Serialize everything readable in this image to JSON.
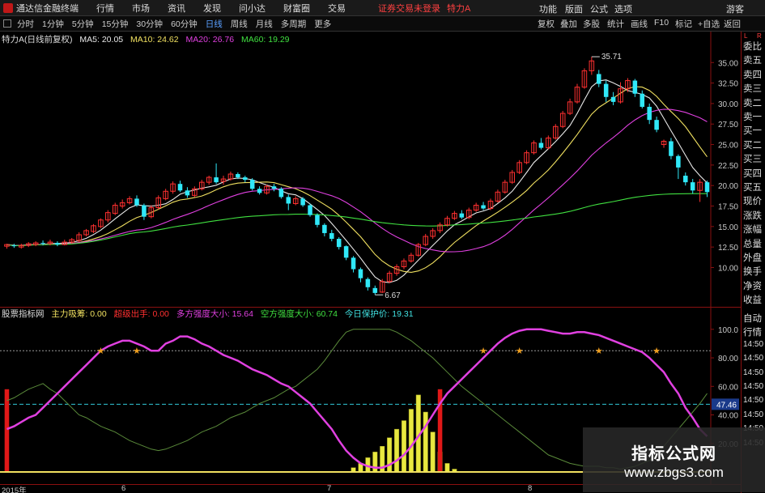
{
  "menubar": {
    "app_title": "通达信金融终端",
    "items": [
      "行情",
      "市场",
      "资讯",
      "发现",
      "问小达",
      "财富圈",
      "交易"
    ],
    "warning": "证券交易未登录",
    "stock_name": "特力A",
    "right_items": [
      "功能",
      "版面",
      "公式",
      "选项",
      "游客"
    ]
  },
  "toolbar": {
    "periods": [
      "分时",
      "1分钟",
      "5分钟",
      "15分钟",
      "30分钟",
      "60分钟",
      "日线",
      "周线",
      "月线",
      "多周期",
      "更多"
    ],
    "active_period": "日线",
    "right_items": [
      "复权",
      "叠加",
      "多股",
      "统计",
      "画线",
      "F10",
      "标记",
      "+自选",
      "返回"
    ]
  },
  "main_legend": {
    "title": "特力A(日线前复权)",
    "items": [
      {
        "text": "MA5: 20.05",
        "color": "#e8e8e8"
      },
      {
        "text": "MA10: 24.62",
        "color": "#f0e060"
      },
      {
        "text": "MA20: 26.76",
        "color": "#e040e0"
      },
      {
        "text": "MA60: 19.29",
        "color": "#40e040"
      }
    ]
  },
  "indicator_legend": {
    "title": "股票指标网",
    "items": [
      {
        "text": "主力吸筹: 0.00",
        "color": "#f0e060"
      },
      {
        "text": "超级出手: 0.00",
        "color": "#ff3030"
      },
      {
        "text": "多方强度大小: 15.64",
        "color": "#e040e0"
      },
      {
        "text": "空方强度大小: 60.74",
        "color": "#40e040"
      },
      {
        "text": "今日保护价: 19.31",
        "color": "#40e0e0"
      }
    ]
  },
  "main_axis_labels": [
    "35.00",
    "32.50",
    "30.00",
    "27.50",
    "25.00",
    "22.50",
    "20.00",
    "17.50",
    "15.00",
    "12.50",
    "10.00"
  ],
  "indicator_axis_labels": [
    "100.0",
    "80.00",
    "60.00",
    "40.00",
    "20.00"
  ],
  "indicator_current_value": "47.46",
  "price_annotations": {
    "high": "35.71",
    "low": "6.67"
  },
  "x_axis_labels": [
    "2015年",
    "6",
    "7",
    "8"
  ],
  "right_panel_items": [
    "委比",
    "卖五",
    "卖四",
    "卖三",
    "卖二",
    "卖一",
    "买一",
    "买二",
    "买三",
    "买四",
    "买五",
    "现价",
    "涨跌",
    "涨幅",
    "总量",
    "外盘",
    "换手",
    "净资",
    "收益",
    "自动",
    "行情",
    "14:50",
    "14:50",
    "14:50",
    "14:50",
    "14:50",
    "14:50",
    "14:50",
    "14:50"
  ],
  "right_panel_lr": [
    "L",
    "R"
  ],
  "watermark": {
    "title": "指标公式网",
    "url": "www.zbgs3.com"
  },
  "colors": {
    "up": "#ff3030",
    "down": "#30e8f8",
    "ma5": "#e8e8e8",
    "ma10": "#f0e060",
    "ma20": "#e040e0",
    "ma60": "#40e040",
    "grid": "#8a1010"
  },
  "chart_data": {
    "type": "candlestick",
    "title": "特力A(日线前复权)",
    "ylim": [
      6,
      37
    ],
    "candles": [
      [
        12.6,
        12.8,
        12.3,
        12.9
      ],
      [
        12.7,
        12.6,
        12.4,
        12.9
      ],
      [
        12.5,
        12.7,
        12.3,
        12.9
      ],
      [
        12.7,
        12.9,
        12.5,
        13.1
      ],
      [
        12.8,
        13.0,
        12.6,
        13.2
      ],
      [
        13.0,
        12.9,
        12.7,
        13.3
      ],
      [
        12.9,
        13.1,
        12.7,
        13.4
      ],
      [
        13.0,
        12.8,
        12.6,
        13.2
      ],
      [
        12.8,
        13.1,
        12.7,
        13.4
      ],
      [
        13.1,
        13.4,
        12.9,
        13.6
      ],
      [
        13.3,
        14.0,
        13.1,
        14.3
      ],
      [
        14.0,
        14.5,
        13.8,
        14.7
      ],
      [
        14.4,
        15.1,
        14.2,
        15.3
      ],
      [
        15.0,
        15.8,
        14.8,
        16.0
      ],
      [
        15.8,
        16.7,
        15.5,
        17.0
      ],
      [
        16.6,
        17.6,
        16.4,
        17.9
      ],
      [
        17.5,
        17.9,
        17.2,
        18.3
      ],
      [
        17.9,
        18.4,
        17.7,
        18.7
      ],
      [
        18.4,
        17.6,
        17.4,
        18.8
      ],
      [
        17.6,
        16.2,
        15.8,
        17.8
      ],
      [
        16.2,
        17.3,
        16.0,
        17.6
      ],
      [
        17.3,
        18.5,
        17.1,
        18.8
      ],
      [
        18.4,
        19.3,
        18.2,
        19.6
      ],
      [
        19.3,
        20.2,
        19.0,
        20.5
      ],
      [
        20.2,
        19.4,
        19.2,
        20.6
      ],
      [
        19.4,
        18.8,
        18.5,
        19.8
      ],
      [
        18.8,
        19.6,
        18.6,
        19.9
      ],
      [
        19.6,
        20.4,
        19.4,
        20.7
      ],
      [
        20.4,
        21.0,
        20.1,
        21.2
      ],
      [
        21.0,
        20.4,
        20.2,
        22.7
      ],
      [
        20.5,
        20.8,
        20.1,
        21.2
      ],
      [
        20.8,
        21.4,
        20.6,
        21.7
      ],
      [
        21.4,
        21.0,
        20.8,
        21.6
      ],
      [
        21.0,
        20.7,
        20.4,
        21.2
      ],
      [
        20.7,
        19.6,
        19.4,
        20.9
      ],
      [
        19.6,
        19.1,
        18.9,
        19.9
      ],
      [
        19.1,
        19.9,
        18.9,
        20.1
      ],
      [
        19.9,
        19.6,
        19.3,
        20.2
      ],
      [
        19.6,
        18.6,
        18.4,
        19.8
      ],
      [
        18.6,
        17.8,
        17.0,
        18.9
      ],
      [
        17.8,
        18.4,
        17.6,
        18.7
      ],
      [
        18.4,
        17.6,
        17.4,
        18.6
      ],
      [
        17.6,
        16.4,
        16.2,
        17.8
      ],
      [
        16.4,
        15.2,
        14.9,
        16.6
      ],
      [
        15.2,
        14.2,
        13.8,
        15.4
      ],
      [
        14.2,
        13.5,
        13.2,
        14.6
      ],
      [
        13.5,
        12.5,
        12.2,
        13.7
      ],
      [
        12.6,
        11.2,
        10.9,
        12.7
      ],
      [
        11.2,
        9.8,
        9.4,
        11.4
      ],
      [
        9.8,
        8.7,
        8.2,
        10.0
      ],
      [
        8.6,
        7.6,
        7.2,
        8.8
      ],
      [
        7.5,
        6.9,
        6.67,
        7.8
      ],
      [
        7.0,
        8.3,
        6.9,
        8.6
      ],
      [
        8.3,
        9.3,
        8.1,
        9.6
      ],
      [
        9.3,
        10.1,
        9.0,
        10.4
      ],
      [
        10.1,
        10.8,
        9.8,
        11.1
      ],
      [
        10.8,
        11.5,
        10.6,
        11.8
      ],
      [
        11.5,
        12.8,
        11.3,
        13.0
      ],
      [
        12.8,
        13.8,
        12.6,
        14.1
      ],
      [
        13.8,
        14.5,
        13.5,
        14.8
      ],
      [
        14.5,
        15.2,
        14.2,
        15.5
      ],
      [
        15.2,
        16.0,
        15.0,
        16.3
      ],
      [
        16.0,
        16.6,
        15.8,
        16.9
      ],
      [
        16.6,
        16.1,
        15.9,
        17.0
      ],
      [
        16.1,
        17.0,
        15.9,
        17.3
      ],
      [
        17.0,
        17.6,
        16.8,
        17.9
      ],
      [
        17.6,
        17.2,
        17.0,
        18.0
      ],
      [
        17.2,
        18.1,
        17.0,
        18.4
      ],
      [
        18.1,
        19.2,
        17.9,
        19.5
      ],
      [
        19.2,
        20.4,
        19.0,
        20.7
      ],
      [
        20.4,
        21.6,
        20.2,
        21.9
      ],
      [
        21.6,
        22.8,
        21.4,
        23.1
      ],
      [
        22.8,
        24.0,
        22.6,
        24.3
      ],
      [
        24.0,
        25.2,
        23.8,
        25.5
      ],
      [
        25.2,
        24.6,
        24.4,
        25.8
      ],
      [
        24.6,
        25.8,
        24.4,
        26.1
      ],
      [
        25.8,
        27.2,
        25.6,
        27.5
      ],
      [
        27.2,
        28.8,
        27.0,
        29.1
      ],
      [
        28.8,
        30.2,
        28.6,
        30.6
      ],
      [
        30.2,
        32.0,
        30.0,
        32.4
      ],
      [
        32.0,
        34.0,
        31.8,
        34.3
      ],
      [
        34.0,
        35.2,
        33.5,
        35.71
      ],
      [
        33.6,
        32.4,
        32.0,
        34.1
      ],
      [
        32.4,
        30.8,
        30.2,
        32.8
      ],
      [
        30.8,
        30.2,
        29.8,
        31.4
      ],
      [
        30.2,
        31.8,
        30.0,
        32.6
      ],
      [
        31.8,
        32.8,
        31.4,
        33.1
      ],
      [
        32.8,
        31.2,
        30.8,
        33.0
      ],
      [
        31.2,
        29.6,
        29.4,
        31.6
      ],
      [
        29.6,
        28.0,
        27.5,
        30.0
      ],
      [
        28.0,
        26.8,
        26.5,
        28.4
      ],
      [
        25.0,
        25.4,
        24.6,
        25.6
      ],
      [
        25.4,
        23.6,
        23.2,
        25.8
      ],
      [
        23.6,
        22.2,
        20.8,
        23.8
      ],
      [
        21.2,
        20.4,
        20.0,
        21.6
      ],
      [
        20.4,
        19.4,
        19.0,
        20.8
      ],
      [
        19.4,
        20.4,
        18.0,
        20.8
      ],
      [
        20.4,
        19.2,
        18.6,
        20.6
      ]
    ],
    "indicator": {
      "ylim": [
        0,
        105
      ],
      "strong": [
        30,
        32,
        35,
        38,
        40,
        45,
        50,
        55,
        60,
        65,
        70,
        75,
        80,
        85,
        88,
        90,
        92,
        92,
        90,
        88,
        85,
        85,
        90,
        92,
        95,
        95,
        93,
        90,
        88,
        85,
        82,
        80,
        78,
        75,
        72,
        70,
        68,
        65,
        62,
        60,
        56,
        52,
        48,
        42,
        36,
        30,
        22,
        15,
        10,
        6,
        4,
        3,
        3,
        5,
        8,
        12,
        18,
        25,
        32,
        40,
        48,
        55,
        60,
        65,
        70,
        75,
        80,
        85,
        90,
        94,
        97,
        99,
        100,
        100,
        100,
        99,
        98,
        97,
        97,
        98,
        98,
        97,
        96,
        94,
        92,
        90,
        88,
        86,
        84,
        80,
        75,
        70,
        62,
        55,
        45,
        38,
        30,
        25
      ],
      "weak": [
        50,
        52,
        55,
        58,
        60,
        62,
        58,
        55,
        50,
        45,
        40,
        38,
        35,
        32,
        30,
        28,
        25,
        22,
        20,
        18,
        16,
        15,
        16,
        18,
        20,
        22,
        25,
        28,
        30,
        32,
        35,
        38,
        40,
        42,
        45,
        48,
        50,
        52,
        55,
        58,
        60,
        64,
        68,
        72,
        78,
        85,
        92,
        98,
        100,
        100,
        100,
        100,
        100,
        100,
        98,
        95,
        92,
        88,
        84,
        80,
        75,
        70,
        65,
        60,
        56,
        52,
        48,
        44,
        40,
        36,
        32,
        28,
        24,
        20,
        16,
        12,
        10,
        8,
        6,
        5,
        4,
        4,
        4,
        3,
        3,
        2,
        3,
        4,
        6,
        8,
        12,
        18,
        24,
        30,
        36,
        42,
        48,
        55
      ],
      "bars_yellow": [
        0,
        0,
        0,
        0,
        0,
        0,
        0,
        0,
        0,
        0,
        0,
        0,
        0,
        0,
        0,
        0,
        0,
        0,
        0,
        0,
        0,
        0,
        0,
        0,
        0,
        0,
        0,
        0,
        0,
        0,
        0,
        0,
        0,
        0,
        0,
        0,
        0,
        0,
        0,
        0,
        0,
        0,
        0,
        0,
        0,
        0,
        0,
        0,
        3,
        6,
        10,
        14,
        18,
        24,
        30,
        36,
        44,
        54,
        42,
        28,
        14,
        6,
        2,
        0,
        0,
        0,
        0,
        0,
        0,
        0,
        0,
        0,
        0,
        0,
        0,
        0,
        0,
        0,
        0,
        0,
        0,
        0,
        0,
        0,
        0,
        0,
        0,
        0,
        0,
        0,
        0,
        0,
        0,
        0,
        0,
        0,
        0,
        0
      ],
      "bars_red_index": [
        0,
        60
      ],
      "signal_index": [
        13,
        18,
        66,
        71,
        82,
        90
      ],
      "level_line": 85,
      "protect_line": 47.46
    }
  }
}
